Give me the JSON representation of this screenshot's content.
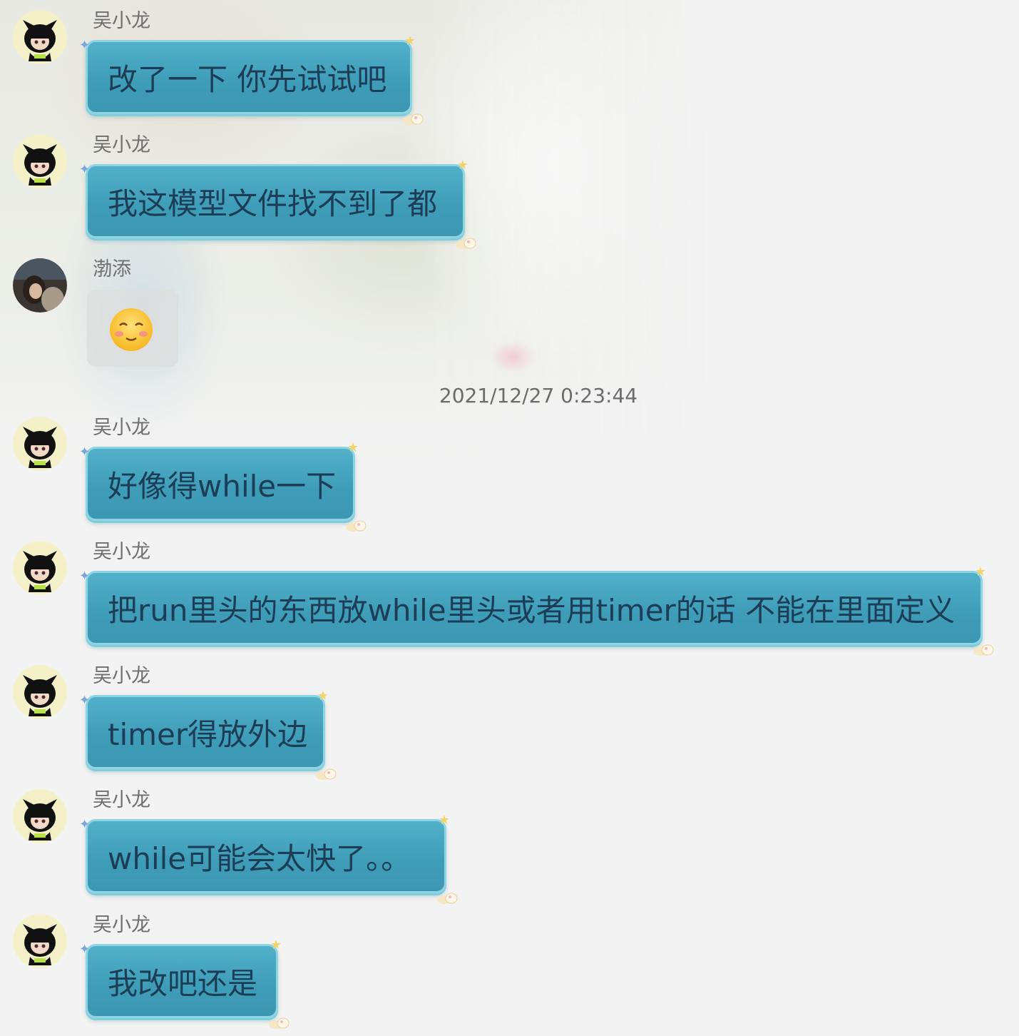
{
  "timestamp": "2021/12/27 0:23:44",
  "messages": [
    {
      "sender": "吴小龙",
      "text": "改了一下 你先试试吧"
    },
    {
      "sender": "吴小龙",
      "text": "我这模型文件找不到了都"
    },
    {
      "sender": "渤添",
      "sticker": "blushing-smile-emoji"
    },
    {
      "sender": "吴小龙",
      "text": "好像得while一下"
    },
    {
      "sender": "吴小龙",
      "text": "把run里头的东西放while里头或者用timer的话 不能在里面定义"
    },
    {
      "sender": "吴小龙",
      "text": "timer得放外边"
    },
    {
      "sender": "吴小龙",
      "text": "while可能会太快了。。"
    },
    {
      "sender": "吴小龙",
      "text": "我改吧还是"
    }
  ],
  "colors": {
    "bubble": "#3f9db8",
    "bubble_border": "#8fd4e2",
    "bubble_text": "#1c3d57",
    "background": "#f3f3f3"
  }
}
